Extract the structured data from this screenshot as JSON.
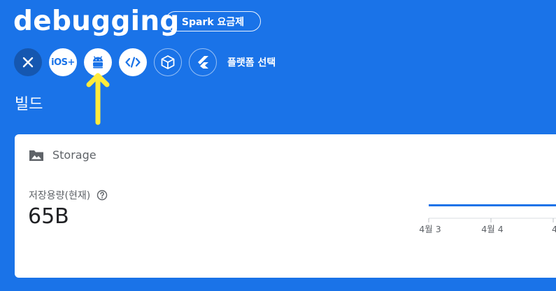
{
  "header": {
    "project_name": "debugging",
    "plan_badge": "Spark 요금제"
  },
  "platforms": {
    "buttons": [
      {
        "name": "close",
        "label": "✕"
      },
      {
        "name": "ios",
        "label": "iOS+"
      },
      {
        "name": "android",
        "label": "android"
      },
      {
        "name": "web",
        "label": "</>"
      },
      {
        "name": "unity",
        "label": "unity"
      },
      {
        "name": "flutter",
        "label": "flutter"
      }
    ],
    "select_label": "플랫폼 선택"
  },
  "section": {
    "title": "빌드"
  },
  "storage_card": {
    "title": "Storage",
    "metric_label": "저장용량(현재)",
    "metric_value": "65B"
  },
  "chart_data": {
    "type": "line",
    "categories": [
      "4월 3",
      "4월 4",
      "4"
    ],
    "series": [
      {
        "values": [
          65,
          65,
          65
        ]
      }
    ],
    "color": "#1a73e8"
  },
  "colors": {
    "background": "#1a73e8",
    "arrow": "#ffeb3b",
    "card": "#ffffff"
  }
}
